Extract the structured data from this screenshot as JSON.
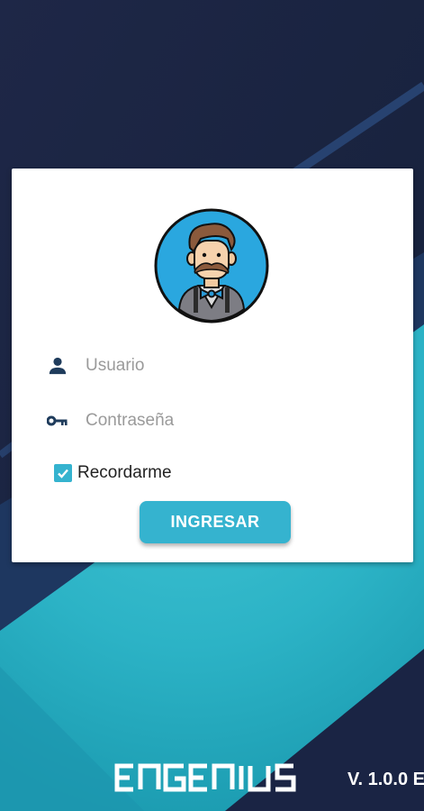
{
  "login": {
    "username_placeholder": "Usuario",
    "password_placeholder": "Contraseña",
    "remember_label": "Recordarme",
    "remember_checked": true,
    "submit_label": "INGRESAR"
  },
  "footer": {
    "brand": "ENGENIUS",
    "version": "V. 1.0.0 E"
  },
  "colors": {
    "accent": "#35b3cf",
    "background_dark": "#1c2544",
    "background_teal": "#2fb8cc",
    "icon": "#1f3c5c"
  },
  "icons": {
    "user": "person-icon",
    "password": "key-icon",
    "checkbox": "check-icon"
  }
}
